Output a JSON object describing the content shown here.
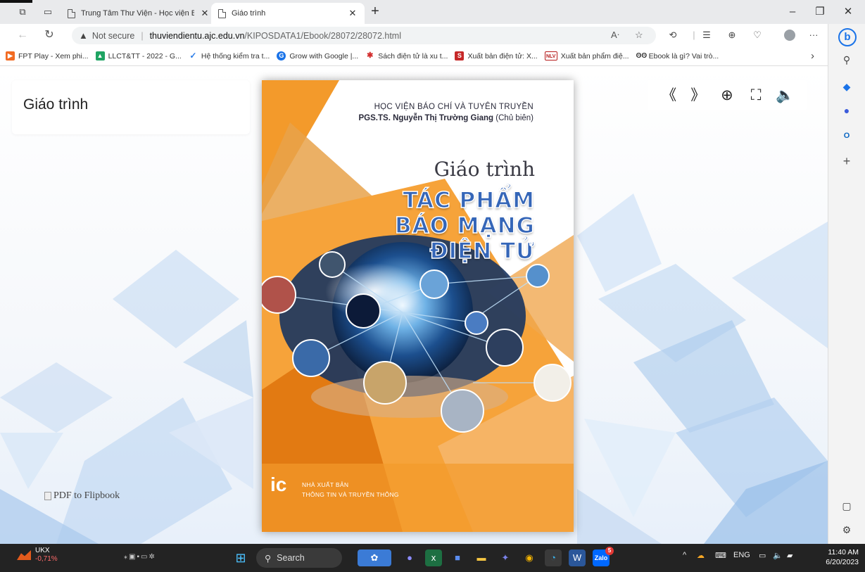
{
  "browser": {
    "tabs": [
      {
        "title": "Trung Tâm Thư Viện - Học viện B",
        "active": false
      },
      {
        "title": "Giáo trình",
        "active": true
      }
    ],
    "address": {
      "security_label": "Not secure",
      "url_host": "thuviendientu.ajc.edu.vn",
      "url_path": "/KIPOSDATA1/Ebook/28072/28072.html"
    },
    "favorites": [
      {
        "label": "FPT Play - Xem phi...",
        "icon_color": "#f26b22",
        "icon": "play"
      },
      {
        "label": "LLCT&TT - 2022 - G...",
        "icon_color": "#1fa463",
        "icon": "drive"
      },
      {
        "label": "Hệ thống kiểm tra t...",
        "icon_color": "#2b7de9",
        "icon": "check"
      },
      {
        "label": "Grow with Google |...",
        "icon_color": "#1a73e8",
        "icon": "google"
      },
      {
        "label": "Sách điện tử là xu t...",
        "icon_color": "#d32f2f",
        "icon": "star"
      },
      {
        "label": "Xuất bản điện tử: X...",
        "icon_color": "#c62828",
        "icon": "book"
      },
      {
        "label": "Xuất bản phẩm điệ...",
        "icon_color": "#b71c1c",
        "icon": "nlv"
      },
      {
        "label": "Ebook là gì? Vai trò...",
        "icon_color": "#333333",
        "icon": "owl"
      }
    ]
  },
  "page": {
    "title": "Giáo trình",
    "pdf_link_alt": "PDF to Flipbook",
    "toolbar": {
      "first_icon": "double-left-icon",
      "last_icon": "double-right-icon",
      "zoom_icon": "zoom-in-icon",
      "fullscreen_icon": "fullscreen-icon",
      "sound_icon": "speaker-icon"
    }
  },
  "cover": {
    "publisher_line": "HỌC VIỆN BÁO CHÍ VÀ TUYÊN TRUYỀN",
    "author": "PGS.TS. Nguyễn Thị Trường Giang",
    "editor_role": "(Chủ biên)",
    "series": "Giáo trình",
    "title_lines": [
      "TÁC PHẨM",
      "BÁO MẠNG",
      "ĐIỆN TỬ"
    ],
    "publisher_logo": "ic",
    "publisher_name_1": "NHÀ XUẤT BẢN",
    "publisher_name_2": "THÔNG TIN VÀ TRUYỀN THÔNG",
    "colors": {
      "orange": "#f39a2b",
      "dark_orange": "#e27a12",
      "title_blue": "#3566b8"
    }
  },
  "taskbar": {
    "weather_name": "UKX",
    "weather_value": "-0,71%",
    "search_label": "Search",
    "language": "ENG",
    "time": "11:40 AM",
    "date": "6/20/2023",
    "zalo_badge": "5"
  }
}
